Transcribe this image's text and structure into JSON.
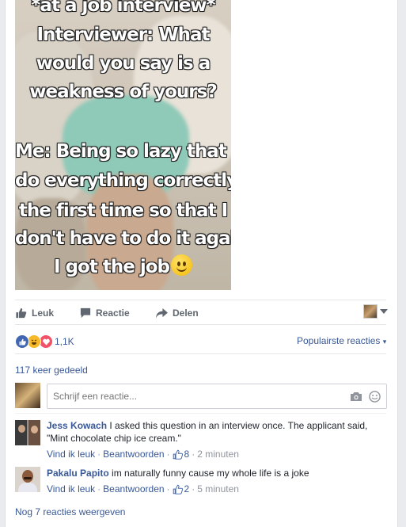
{
  "post": {
    "caption_lines": [
      "*at a job interview*",
      "Interviewer: What",
      "would you say is a",
      "weakness of yours?",
      "Me: Being so lazy that I",
      "do everything correctly",
      "the first time so that I",
      "don't have to do it again.",
      "I got the job"
    ]
  },
  "actions": {
    "like": "Leuk",
    "comment": "Reactie",
    "share": "Delen"
  },
  "reactions": {
    "count": "1,1K",
    "sort_label": "Populairste reacties",
    "sort_caret": "▾",
    "shares": "117 keer gedeeld"
  },
  "reply_box": {
    "placeholder": "Schrijf een reactie..."
  },
  "comments": [
    {
      "author": "Jess Kowach",
      "text": "I asked this question in an interview once. The applicant said, \"Mint chocolate chip ice cream.\"",
      "like_label": "Vind ik leuk",
      "reply_label": "Beantwoorden",
      "likes": "8",
      "time": "2 minuten"
    },
    {
      "author": "Pakalu Papito",
      "text": "im naturally funny cause my whole life is a joke",
      "like_label": "Vind ik leuk",
      "reply_label": "Beantwoorden",
      "likes": "2",
      "time": "5 minuten"
    }
  ],
  "more_comments": "Nog 7 reacties weergeven",
  "separator": "·",
  "icons": [
    "like-icon",
    "comment-icon",
    "share-icon",
    "dropdown-icon",
    "camera-icon",
    "emoji-icon",
    "thumbs-up-icon",
    "haha-icon",
    "love-icon"
  ],
  "colors": {
    "link": "#385898",
    "muted": "#90949c",
    "like_blue": "#4267b2",
    "love_red": "#f25268",
    "haha_yellow": "#f7b928"
  }
}
